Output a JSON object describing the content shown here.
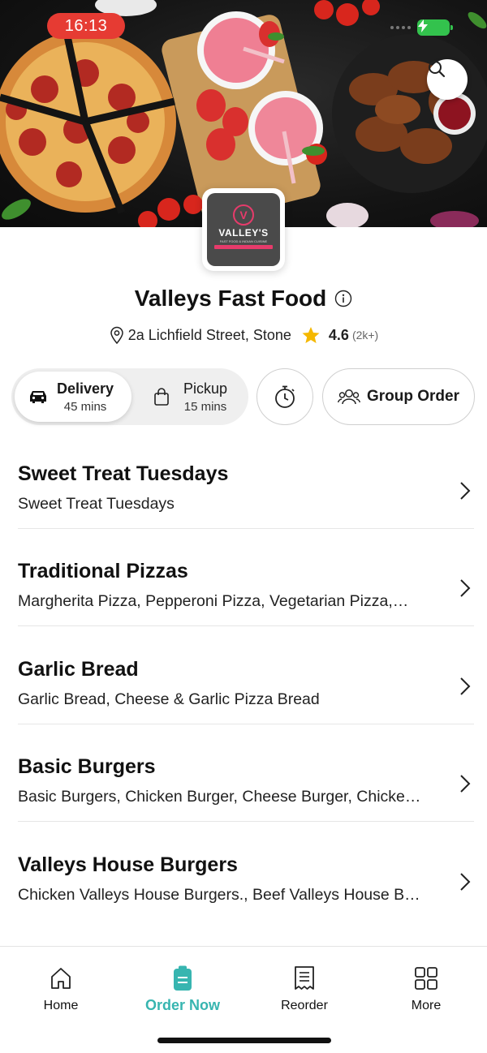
{
  "status_bar": {
    "time": "16:13"
  },
  "icons": {
    "search": "search-icon",
    "info": "info-icon",
    "location": "location-pin-icon",
    "star": "star-icon",
    "car": "car-icon",
    "bag": "shopping-bag-icon",
    "timer": "stopwatch-icon",
    "group": "group-icon",
    "chevron": "chevron-right-icon"
  },
  "logo": {
    "text": "VALLEY'S",
    "tagline": "FAST FOOD & INDIAN CUISINE"
  },
  "restaurant": {
    "name": "Valleys Fast Food",
    "address": "2a Lichfield Street, Stone",
    "rating": "4.6",
    "rating_count": "(2k+)"
  },
  "order_modes": {
    "delivery": {
      "label": "Delivery",
      "time": "45 mins",
      "selected": true
    },
    "pickup": {
      "label": "Pickup",
      "time": "15 mins",
      "selected": false
    }
  },
  "group_order": {
    "label": "Group Order"
  },
  "categories": [
    {
      "title": "Sweet Treat Tuesdays",
      "desc": "Sweet Treat Tuesdays"
    },
    {
      "title": "Traditional Pizzas",
      "desc": "Margherita Pizza, Pepperoni Pizza, Vegetarian Pizza,…"
    },
    {
      "title": "Garlic Bread",
      "desc": "Garlic Bread, Cheese & Garlic Pizza Bread"
    },
    {
      "title": "Basic Burgers",
      "desc": "Basic Burgers, Chicken Burger, Cheese Burger, Chicke…"
    },
    {
      "title": "Valleys House Burgers",
      "desc": "Chicken Valleys House Burgers., Beef Valleys House B…"
    }
  ],
  "tabbar": {
    "home": "Home",
    "order_now": "Order Now",
    "reorder": "Reorder",
    "more": "More"
  },
  "colors": {
    "accent": "#37b5b0",
    "status_time_bg": "#e63b33",
    "star": "#f5b800",
    "battery": "#33c24d"
  }
}
